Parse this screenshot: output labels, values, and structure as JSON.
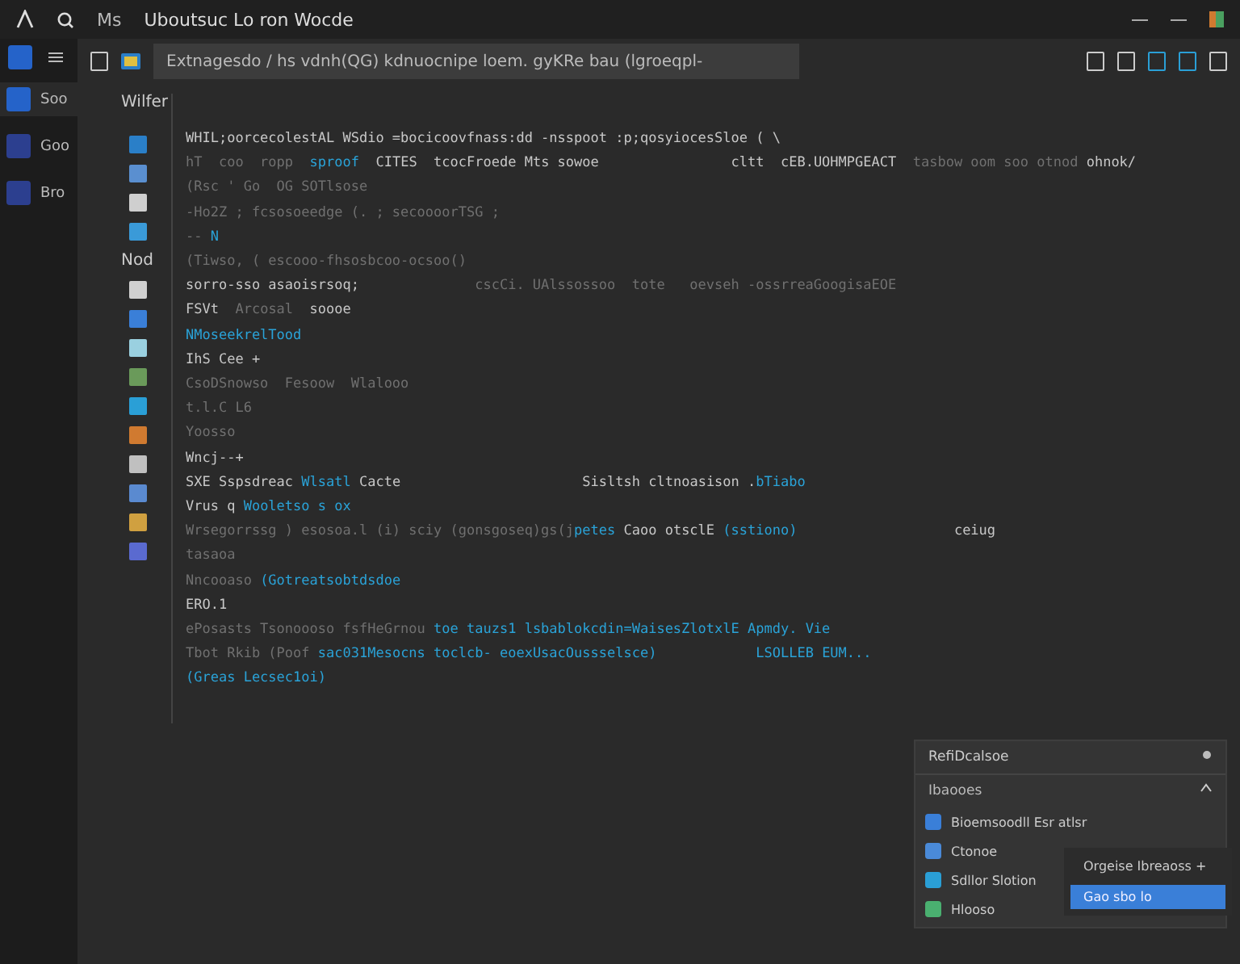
{
  "window": {
    "app_label": "Ms",
    "title": "Uboutsuc Lo ron Wocde"
  },
  "activity_bar": [
    {
      "label": "Soo",
      "selected": true
    },
    {
      "label": "Goo",
      "selected": false
    },
    {
      "label": "Bro",
      "selected": false
    }
  ],
  "search": {
    "value": "Extnagesdo / hs vdnh(QG) kdnuocnipe loem. gyKRe bau (lgroeqpl-"
  },
  "editor": {
    "header_label": "Wilfer",
    "gutter_label": "Nod",
    "lines": [
      {
        "segments": [
          {
            "text": "WHIL;oorcecolestAL WSdio =bocicoovfnass:dd -nsspoot :p;qosyiocesSloe ( \\",
            "kind": "plain"
          }
        ]
      },
      {
        "segments": [
          {
            "text": "hT  coo  ropp  ",
            "kind": "dim"
          },
          {
            "text": "sproof",
            "kind": "accent"
          },
          {
            "text": "  CITES  tcocFroede Mts sowoe",
            "kind": "plain"
          },
          {
            "text": "                cltt  cEB.UOHMPGEACT  ",
            "kind": "plain"
          },
          {
            "text": "tasbow oom soo otnod",
            "kind": "dim"
          },
          {
            "text": " ohnok/",
            "kind": "plain"
          }
        ]
      },
      {
        "segments": [
          {
            "text": "(Rsc ' Go  OG SOTlsose",
            "kind": "dim"
          }
        ]
      },
      {
        "segments": [
          {
            "text": "-Ho2Z ; fcsosoeedge (. ; secoooorTSG ;",
            "kind": "dim"
          }
        ]
      },
      {
        "segments": [
          {
            "text": "-- ",
            "kind": "dim"
          },
          {
            "text": "N",
            "kind": "accent"
          }
        ]
      },
      {
        "segments": [
          {
            "text": "(Tiwso, ( escooo-fhsosbcoo-ocsoo()",
            "kind": "dim"
          }
        ]
      },
      {
        "segments": [
          {
            "text": "sorro-sso asaoisrsoq;",
            "kind": "plain"
          },
          {
            "text": "              cscCi. UAlssossoo  tote   oevseh -ossrreaGoogisaEOE",
            "kind": "dim"
          }
        ]
      },
      {
        "segments": [
          {
            "text": "FSVt  ",
            "kind": "plain"
          },
          {
            "text": "Arcosal",
            "kind": "dim"
          },
          {
            "text": "  soooe",
            "kind": "plain"
          }
        ]
      },
      {
        "segments": [
          {
            "text": "NMoseekrelTood",
            "kind": "accent"
          }
        ]
      },
      {
        "segments": [
          {
            "text": "IhS Cee +",
            "kind": "plain"
          }
        ]
      },
      {
        "segments": [
          {
            "text": "CsoDSnowso  Fesoow  Wlalooo",
            "kind": "dim"
          }
        ]
      },
      {
        "segments": [
          {
            "text": "t.l.C L6",
            "kind": "dim"
          }
        ]
      },
      {
        "segments": [
          {
            "text": "Yoosso",
            "kind": "dim"
          }
        ]
      },
      {
        "segments": [
          {
            "text": "Wncj--+",
            "kind": "plain"
          }
        ]
      },
      {
        "segments": [
          {
            "text": "SXE Sspsdreac ",
            "kind": "plain"
          },
          {
            "text": "Wlsatl",
            "kind": "accent"
          },
          {
            "text": " Cacte",
            "kind": "plain"
          },
          {
            "text": "                      Sisltsh cltnoasison .",
            "kind": "plain"
          },
          {
            "text": "bTiabo",
            "kind": "accent"
          }
        ]
      },
      {
        "segments": [
          {
            "text": "Vrus q ",
            "kind": "plain"
          },
          {
            "text": "Wooletso s ox",
            "kind": "accent"
          }
        ]
      },
      {
        "segments": [
          {
            "text": "Wrsegorrssg ) esosoa.l (i) sciy (gonsgoseq)gs(j",
            "kind": "dim"
          },
          {
            "text": "petes",
            "kind": "accent"
          },
          {
            "text": " Caoo otsclE ",
            "kind": "plain"
          },
          {
            "text": "(sstiono)",
            "kind": "accent"
          },
          {
            "text": "                   ceiug",
            "kind": "plain"
          }
        ]
      },
      {
        "segments": [
          {
            "text": "tasaoa",
            "kind": "dim"
          }
        ]
      },
      {
        "segments": [
          {
            "text": "Nncooaso ",
            "kind": "dim"
          },
          {
            "text": "(Gotreatsobtdsdoe",
            "kind": "accent"
          }
        ]
      },
      {
        "segments": [
          {
            "text": "ERO.1",
            "kind": "plain"
          }
        ]
      },
      {
        "segments": [
          {
            "text": "ePosasts Tsonoooso fsfHeGrnou ",
            "kind": "dim"
          },
          {
            "text": "toe tauzs1 lsbablokcdin=WaisesZlotxlE Apmdy. Vie",
            "kind": "accent"
          }
        ]
      },
      {
        "segments": [
          {
            "text": "Tbot Rkib (Poof ",
            "kind": "dim"
          },
          {
            "text": "sac031Mesocns toclcb- eoexUsacOussselsce)",
            "kind": "accent"
          },
          {
            "text": "            LSOLLEB EUM...",
            "kind": "accent"
          }
        ]
      },
      {
        "segments": [
          {
            "text": "(Greas Lecsec1oi)",
            "kind": "accent"
          }
        ]
      }
    ]
  },
  "panel": {
    "title": "RefiDcalsoe",
    "section": "Ibaooes",
    "items": [
      {
        "label": "Bioemsoodll Esr atlsr"
      },
      {
        "label": "Ctonoe"
      },
      {
        "label": "Sdllor Slotion"
      },
      {
        "label": "Hlooso"
      }
    ],
    "menu": [
      {
        "label": "Orgeise Ibreaoss +",
        "selected": false
      },
      {
        "label": "Gao sbo lo",
        "selected": true
      }
    ]
  }
}
